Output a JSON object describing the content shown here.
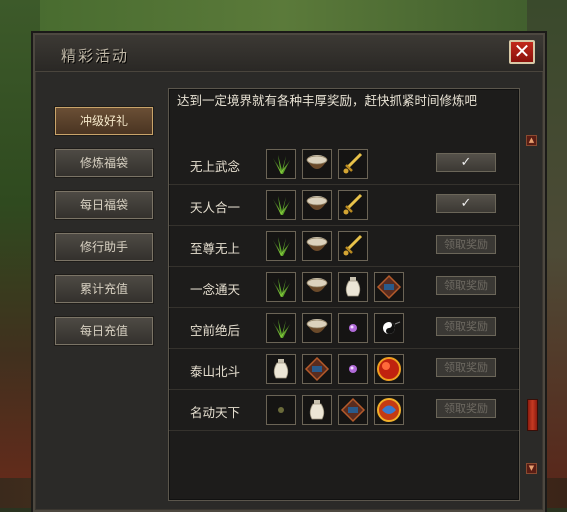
{
  "window": {
    "title": "精彩活动",
    "close_label": "✕"
  },
  "sidebar": {
    "items": [
      {
        "label": "冲级好礼",
        "active": true
      },
      {
        "label": "修炼福袋"
      },
      {
        "label": "每日福袋"
      },
      {
        "label": "修行助手"
      },
      {
        "label": "累计充值"
      },
      {
        "label": "每日充值"
      }
    ]
  },
  "panel": {
    "description": "达到一定境界就有各种丰厚奖励，赶快抓紧时间修炼吧",
    "rows": [
      {
        "label": "无上武念",
        "items": [
          "grass-icon",
          "bowl-icon",
          "sword-icon"
        ],
        "button": "✓",
        "state": "done"
      },
      {
        "label": "天人合一",
        "items": [
          "grass-icon",
          "bowl-icon",
          "sword-icon"
        ],
        "button": "✓",
        "state": "done"
      },
      {
        "label": "至尊无上",
        "items": [
          "grass-icon",
          "bowl-icon",
          "sword-icon"
        ],
        "button": "领取奖励",
        "state": "disabled"
      },
      {
        "label": "一念通天",
        "items": [
          "grass-icon",
          "bowl-icon",
          "vase-icon",
          "chest-icon"
        ],
        "button": "领取奖励",
        "state": "disabled"
      },
      {
        "label": "空前绝后",
        "items": [
          "grass-icon",
          "bowl-icon",
          "pearl-icon",
          "yinyang-icon"
        ],
        "button": "领取奖励",
        "state": "disabled"
      },
      {
        "label": "泰山北斗",
        "items": [
          "vase-icon",
          "chest-icon",
          "pearl-icon",
          "red-orb-icon"
        ],
        "button": "领取奖励",
        "state": "disabled"
      },
      {
        "label": "名动天下",
        "items": [
          "dark-orb-icon",
          "vase-icon",
          "chest-icon",
          "dragon-orb-icon"
        ],
        "button": "领取奖励",
        "state": "disabled"
      }
    ]
  },
  "scrollbar": {
    "up": "▲",
    "down": "▼"
  }
}
